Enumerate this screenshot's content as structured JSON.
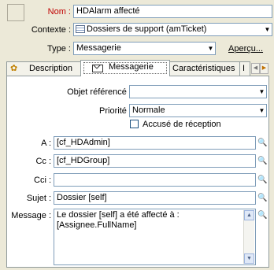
{
  "header": {
    "nom_label": "Nom :",
    "nom_value": "HDAlarm affecté",
    "contexte_label": "Contexte :",
    "contexte_value": "Dossiers de support (amTicket)",
    "type_label": "Type :",
    "type_value": "Messagerie",
    "apercu_label": "Aperçu..."
  },
  "tabs": [
    {
      "label": "Description",
      "icon": "gears-icon"
    },
    {
      "label": "Messagerie",
      "icon": "envelope-icon",
      "selected": true
    },
    {
      "label": "Caractéristiques"
    },
    {
      "label": "I"
    }
  ],
  "form": {
    "objet_label": "Objet référencé :",
    "objet_value": "",
    "priorite_label": "Priorité :",
    "priorite_value": "Normale",
    "accuse_label": "Accusé de réception",
    "accuse_checked": false,
    "a_label": "A :",
    "a_value": "[cf_HDAdmin]",
    "cc_label": "Cc :",
    "cc_value": "[cf_HDGroup]",
    "cci_label": "Cci :",
    "cci_value": "",
    "sujet_label": "Sujet :",
    "sujet_value": "Dossier [self]",
    "message_label": "Message :",
    "message_line1": "Le dossier [self] a été affecté à :",
    "message_line2": "[Assignee.FullName]"
  },
  "colors": {
    "name_label": "#c00000",
    "window_bg": "#ece9d8",
    "field_border": "#7f9db9"
  }
}
